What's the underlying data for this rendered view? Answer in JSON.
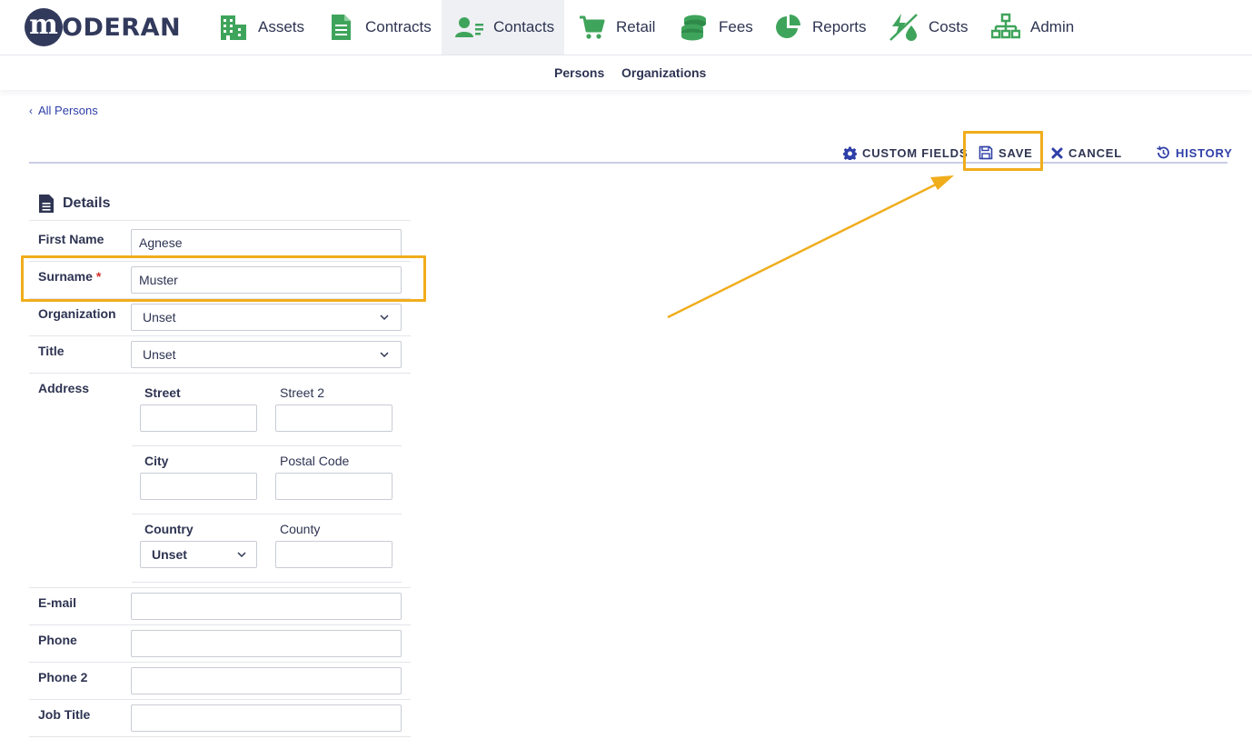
{
  "brand": {
    "logo_letter": "m",
    "logo_text": "ODERAN"
  },
  "nav": {
    "assets": "Assets",
    "contracts": "Contracts",
    "contacts": "Contacts",
    "retail": "Retail",
    "fees": "Fees",
    "reports": "Reports",
    "costs": "Costs",
    "admin": "Admin",
    "active": "Contacts"
  },
  "subnav": {
    "persons": "Persons",
    "organizations": "Organizations"
  },
  "back_link": "All Persons",
  "toolbar": {
    "custom_fields": "CUSTOM FIELDS",
    "save": "SAVE",
    "cancel": "CANCEL",
    "history": "HISTORY"
  },
  "details": {
    "title": "Details",
    "first_name": {
      "label": "First Name",
      "value": "Agnese"
    },
    "surname": {
      "label": "Surname",
      "required_mark": "*",
      "value": "Muster"
    },
    "organization": {
      "label": "Organization",
      "value": "Unset"
    },
    "title_field": {
      "label": "Title",
      "value": "Unset"
    },
    "address": {
      "label": "Address",
      "street": "Street",
      "street2": "Street 2",
      "city": "City",
      "postal_code": "Postal Code",
      "country": "Country",
      "country_value": "Unset",
      "county": "County"
    },
    "email": {
      "label": "E-mail",
      "value": ""
    },
    "phone": {
      "label": "Phone",
      "value": ""
    },
    "phone2": {
      "label": "Phone 2",
      "value": ""
    },
    "job_title": {
      "label": "Job Title",
      "value": ""
    }
  },
  "colors": {
    "accent_highlight": "#f0ad1c",
    "nav_icon_green": "#3fa45b",
    "text_dark": "#2e3452",
    "link_blue": "#2f3fa8"
  },
  "icons": {
    "assets": "buildings-icon",
    "contracts": "document-icon",
    "contacts": "contact-card-icon",
    "retail": "cart-icon",
    "fees": "coins-icon",
    "reports": "pie-chart-icon",
    "costs": "energy-water-icon",
    "admin": "sitemap-icon"
  }
}
